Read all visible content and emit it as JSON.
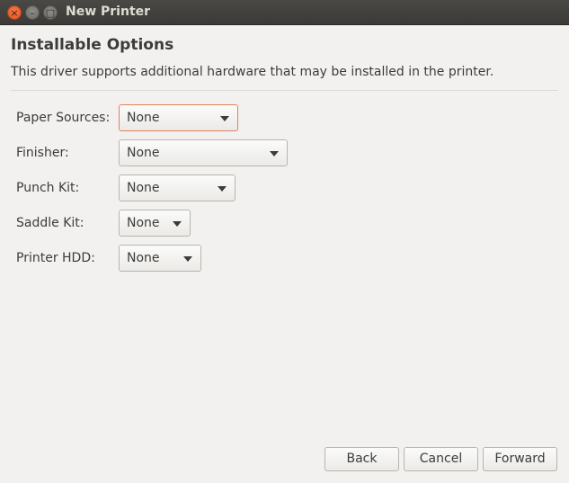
{
  "window": {
    "title": "New Printer",
    "close_glyph": "×",
    "min_glyph": "–",
    "max_glyph": "□"
  },
  "page": {
    "heading": "Installable Options",
    "description": "This driver supports additional hardware that may be installed in the printer."
  },
  "options": [
    {
      "label": "Paper Sources:",
      "value": "None"
    },
    {
      "label": "Finisher:",
      "value": "None"
    },
    {
      "label": "Punch Kit:",
      "value": "None"
    },
    {
      "label": "Saddle Kit:",
      "value": "None"
    },
    {
      "label": "Printer HDD:",
      "value": "None"
    }
  ],
  "buttons": {
    "back": "Back",
    "cancel": "Cancel",
    "forward": "Forward"
  },
  "colors": {
    "focus_border": "#e2805a",
    "close_button": "#e2531f"
  },
  "icons": {
    "close": "close-icon",
    "minimize": "minimize-icon",
    "maximize": "maximize-icon",
    "dropdown": "chevron-down-icon"
  }
}
